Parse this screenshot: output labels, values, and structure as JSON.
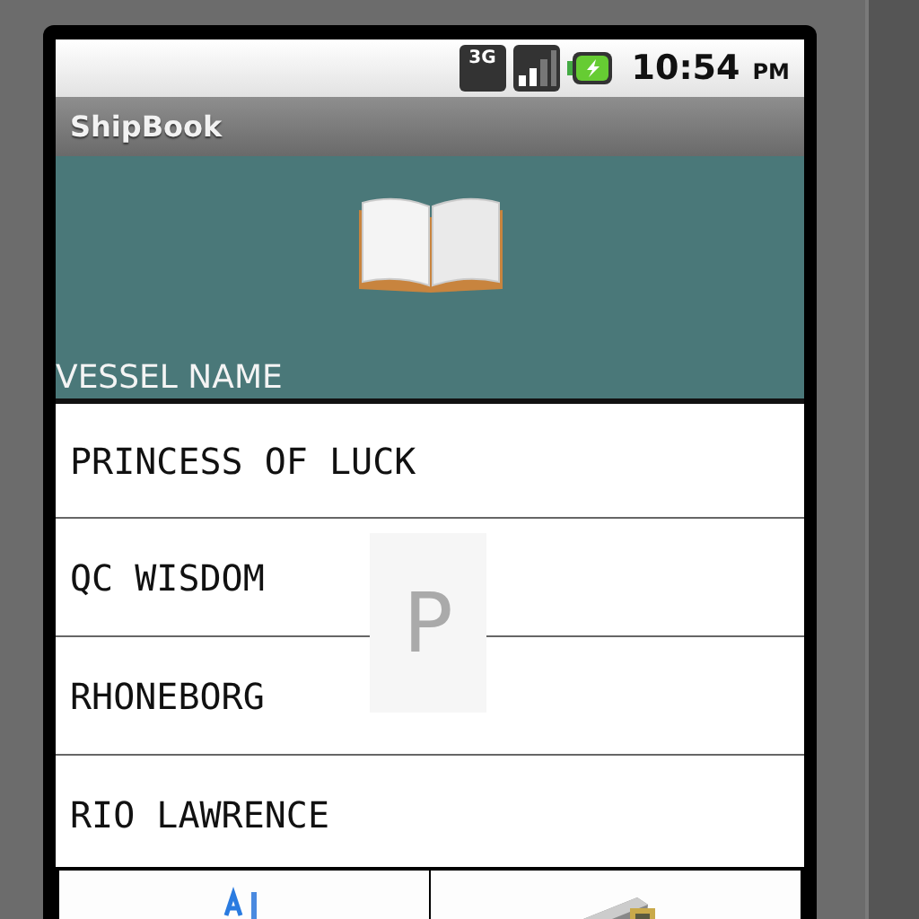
{
  "status_bar": {
    "network": "3G",
    "time": "10:54",
    "meridiem": "PM"
  },
  "app_bar": {
    "title": "ShipBook"
  },
  "header": {
    "column": "VESSEL NAME"
  },
  "vessels": [
    "PRINCESS OF LUCK",
    "QC WISDOM",
    "RHONEBORG",
    "RIO LAWRENCE"
  ],
  "fast_scroll_letter": "P",
  "menu": [
    {
      "kind": "sort"
    },
    {
      "kind": "machine"
    }
  ]
}
